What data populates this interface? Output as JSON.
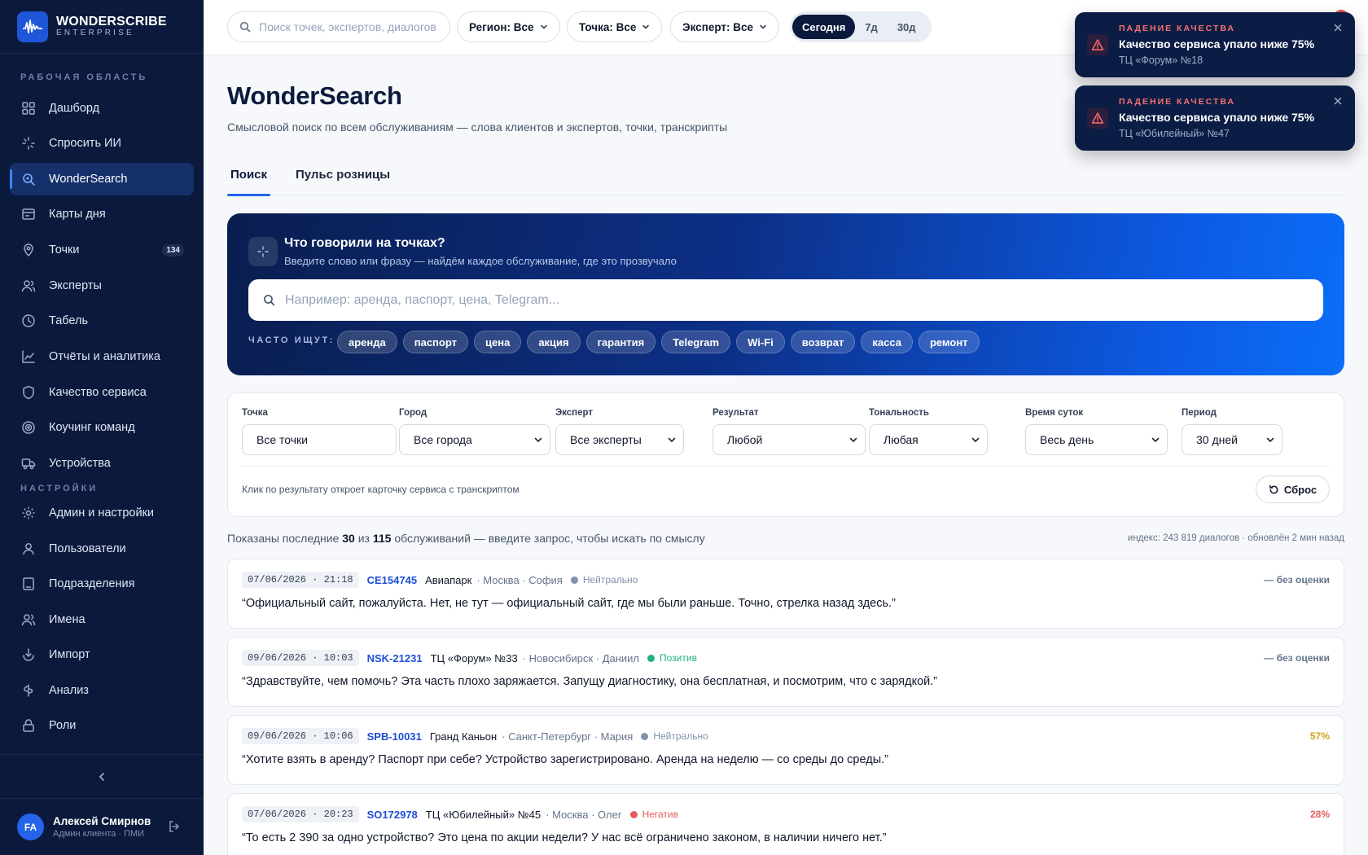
{
  "brand": {
    "name": "WONDERSCRIBE",
    "sub": "ENTERPRISE"
  },
  "sidebar": {
    "workspace_label": "РАБОЧАЯ ОБЛАСТЬ",
    "settings_label": "НАСТРОЙКИ",
    "items": [
      {
        "label": "Дашборд",
        "icon": "dashboard-icon"
      },
      {
        "label": "Спросить ИИ",
        "icon": "sparkle-icon"
      },
      {
        "label": "WonderSearch",
        "icon": "search-icon",
        "active": true
      },
      {
        "label": "Карты дня",
        "icon": "card-icon"
      },
      {
        "label": "Точки",
        "icon": "location-pin-icon",
        "badge": "134"
      },
      {
        "label": "Эксперты",
        "icon": "users-icon"
      },
      {
        "label": "Табель",
        "icon": "clock-icon"
      },
      {
        "label": "Отчёты и аналитика",
        "icon": "chart-icon"
      },
      {
        "label": "Качество сервиса",
        "icon": "shield-icon"
      },
      {
        "label": "Коучинг команд",
        "icon": "target-icon"
      },
      {
        "label": "Устройства",
        "icon": "truck-icon"
      }
    ],
    "settings_items": [
      {
        "label": "Админ и настройки",
        "icon": "gear-icon"
      },
      {
        "label": "Пользователи",
        "icon": "user-icon"
      },
      {
        "label": "Подразделения",
        "icon": "building-icon"
      },
      {
        "label": "Имена",
        "icon": "users-icon"
      },
      {
        "label": "Импорт",
        "icon": "import-icon"
      },
      {
        "label": "Анализ",
        "icon": "brain-icon"
      },
      {
        "label": "Роли",
        "icon": "lock-icon"
      }
    ]
  },
  "user": {
    "initials": "FA",
    "name": "Алексей Смирнов",
    "role": "Админ клиента · ПМИ"
  },
  "topbar": {
    "search_placeholder": "Поиск точек, экспертов, диалогов",
    "region": "Регион: Все",
    "point": "Точка: Все",
    "expert": "Эксперт: Все",
    "periods": [
      "Сегодня",
      "7д",
      "30д"
    ],
    "active_period": "Сегодня"
  },
  "page": {
    "title": "WonderSearch",
    "subtitle": "Смысловой поиск по всем обслуживаниям — слова клиентов и экспертов, точки, транскрипты",
    "tabs": [
      "Поиск",
      "Пульс розницы"
    ]
  },
  "hero": {
    "title": "Что говорили на точках?",
    "subtitle": "Введите слово или фразу — найдём каждое обслуживание, где это прозвучало",
    "placeholder": "Например: аренда, паспорт, цена, Telegram...",
    "often_label": "ЧАСТО ИЩУТ:",
    "chips": [
      "аренда",
      "паспорт",
      "цена",
      "акция",
      "гарантия",
      "Telegram",
      "Wi-Fi",
      "возврат",
      "касса",
      "ремонт"
    ]
  },
  "filters": {
    "fields": [
      {
        "label": "Точка",
        "value": "Все точки"
      },
      {
        "label": "Город",
        "value": "Все города"
      },
      {
        "label": "Эксперт",
        "value": "Все эксперты"
      },
      {
        "label": "Результат",
        "value": "Любой"
      },
      {
        "label": "Тональность",
        "value": "Любая"
      },
      {
        "label": "Время суток",
        "value": "Весь день"
      },
      {
        "label": "Период",
        "value": "30 дней"
      }
    ],
    "hint": "Клик по результату откроет карточку сервиса с транскриптом",
    "reset": "Сброс"
  },
  "results": {
    "prefix": "Показаны последние",
    "shown": "30",
    "of": "из",
    "total": "115",
    "suffix": "обслуживаний — введите запрос, чтобы искать по смыслу",
    "index_info": "индекс: 243 819 диалогов · обновлён 2 мин назад",
    "items": [
      {
        "datetime": "07/06/2026 · 21:18",
        "id": "CE154745",
        "store": "Авиапарк",
        "loc": "· Москва · София",
        "sentiment": "Нейтрально",
        "sentiment_color": "#8190ad",
        "score": "— без оценки",
        "score_color": "#64748b",
        "quote": "“Официальный сайт, пожалуйста. Нет, не тут — официальный сайт, где мы были раньше. Точно, стрелка назад здесь.”"
      },
      {
        "datetime": "09/06/2026 · 10:03",
        "id": "NSK-21231",
        "store": "ТЦ «Форум» №33",
        "loc": "· Новосибирск · Даниил",
        "sentiment": "Позитив",
        "sentiment_color": "#22b07d",
        "score": "— без оценки",
        "score_color": "#64748b",
        "quote": "“Здравствуйте, чем помочь? Эта часть плохо заряжается. Запущу диагностику, она бесплатная, и посмотрим, что с зарядкой.”"
      },
      {
        "datetime": "09/06/2026 · 10:06",
        "id": "SPB-10031",
        "store": "Гранд Каньон",
        "loc": "· Санкт-Петербург · Мария",
        "sentiment": "Нейтрально",
        "sentiment_color": "#8190ad",
        "score": "57%",
        "score_color": "#d4a017",
        "quote": "“Хотите взять в аренду? Паспорт при себе? Устройство зарегистрировано. Аренда на неделю — со среды до среды.”"
      },
      {
        "datetime": "07/06/2026 · 20:23",
        "id": "SO172978",
        "store": "ТЦ «Юбилейный» №45",
        "loc": "· Москва · Олег",
        "sentiment": "Негатив",
        "sentiment_color": "#e25c5c",
        "score": "28%",
        "score_color": "#e25c5c",
        "quote": "“То есть 2 390 за одно устройство? Это цена по акции недели? У нас всё ограничено законом, в наличии ничего нет.”"
      }
    ]
  },
  "toasts": [
    {
      "kicker": "ПАДЕНИЕ КАЧЕСТВА",
      "title": "Качество сервиса упало ниже 75%",
      "sub": "ТЦ «Форум» №18"
    },
    {
      "kicker": "ПАДЕНИЕ КАЧЕСТВА",
      "title": "Качество сервиса упало ниже 75%",
      "sub": "ТЦ «Юбилейный» №47"
    }
  ]
}
